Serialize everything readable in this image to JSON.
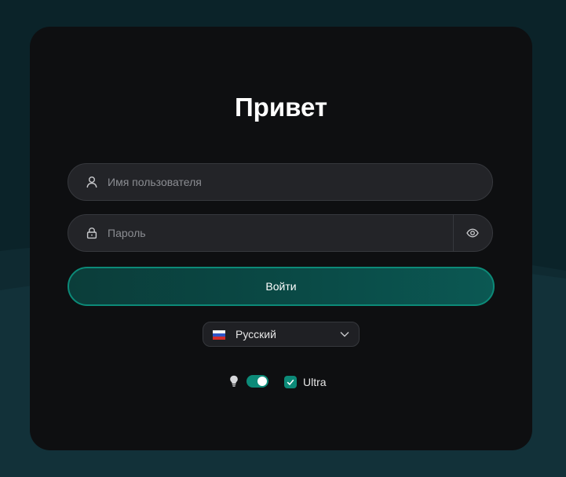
{
  "login": {
    "title": "Привет",
    "username_placeholder": "Имя пользователя",
    "password_placeholder": "Пароль",
    "submit_label": "Войти"
  },
  "language": {
    "selected": "Русский",
    "flag": "ru-flag-icon"
  },
  "settings": {
    "hints_toggle_on": true,
    "ultra_checked": true,
    "ultra_label": "Ultra"
  },
  "colors": {
    "accent": "#0c8a78",
    "card_bg": "#0e0f11",
    "page_bg": "#0b2329",
    "field_bg": "#232428"
  },
  "icons": {
    "username": "user-icon",
    "password": "lock-icon",
    "reveal": "eye-icon",
    "dropdown": "chevron-down-icon",
    "hints": "lightbulb-icon",
    "checkbox": "check-icon"
  }
}
